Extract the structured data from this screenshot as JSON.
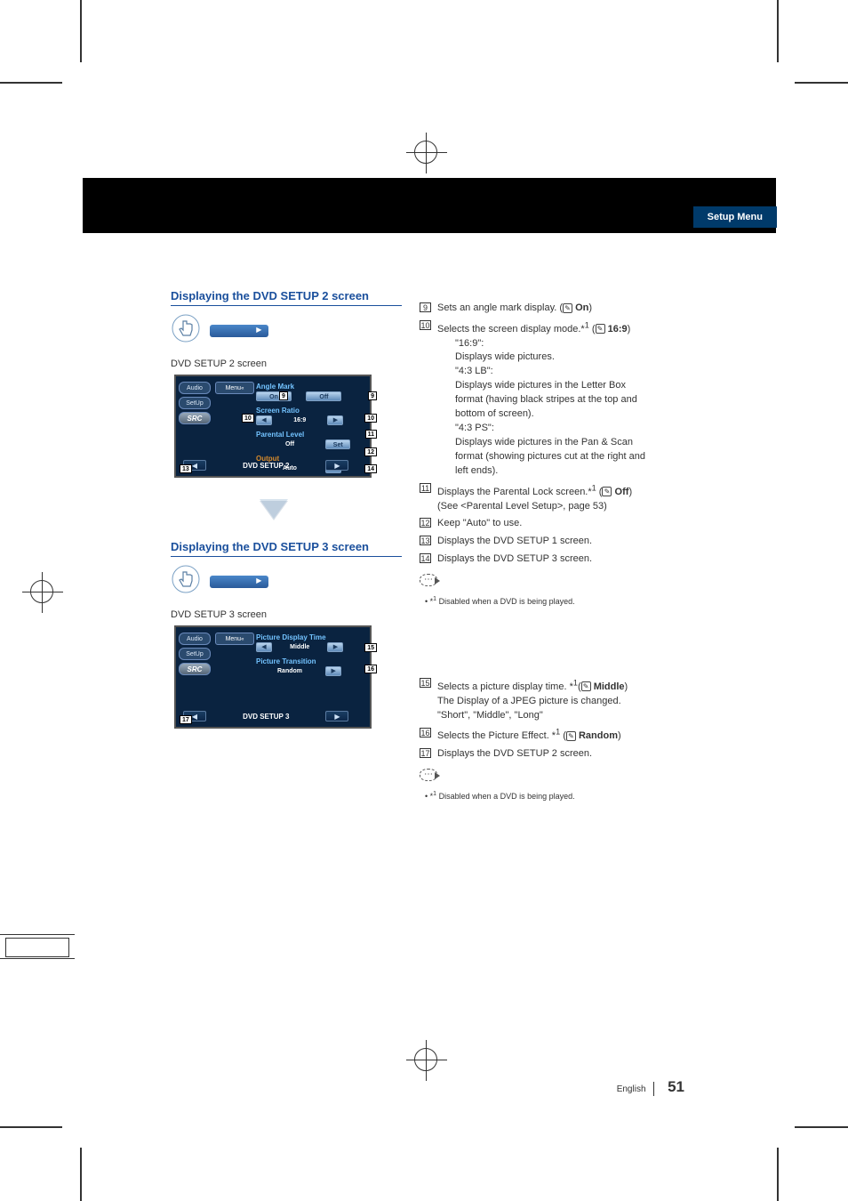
{
  "header": {
    "tab": "Setup Menu"
  },
  "section2": {
    "title": "Displaying the DVD SETUP 2 screen",
    "caption": "DVD SETUP 2 screen",
    "side": {
      "audio": "Audio",
      "setup": "SetUp",
      "src": "SRC"
    },
    "topbar": "Menu",
    "rows": {
      "angle": {
        "label": "Angle Mark",
        "on": "On",
        "off": "Off"
      },
      "ratio": {
        "label": "Screen Ratio",
        "value": "16:9"
      },
      "parental": {
        "label": "Parental Level",
        "off": "Off",
        "set": "Set"
      },
      "output": {
        "label": "Output",
        "value": "Auto"
      }
    },
    "footer": {
      "title": "DVD SETUP 2"
    }
  },
  "section3": {
    "title": "Displaying the DVD SETUP 3 screen",
    "caption": "DVD SETUP 3 screen",
    "side": {
      "audio": "Audio",
      "setup": "SetUp",
      "src": "SRC"
    },
    "topbar": "Menu",
    "rows": {
      "displaytime": {
        "label": "Picture Display Time",
        "value": "Middle"
      },
      "transition": {
        "label": "Picture Transition",
        "value": "Random"
      }
    },
    "footer": {
      "title": "DVD SETUP 3"
    }
  },
  "right2": {
    "i9": {
      "num": "9",
      "text": "Sets an angle mark display. (",
      "default": "On",
      "tail": ")"
    },
    "i10": {
      "num": "10",
      "text": "Selects the screen display mode.*",
      "sup": "1",
      "open": " (",
      "default": "16:9",
      "tail": ")",
      "d1k": "\"16:9\":",
      "d1v": "Displays wide pictures.",
      "d2k": "\"4:3 LB\":",
      "d2v": "Displays wide pictures in the Letter Box format (having black stripes at the top and bottom of screen).",
      "d3k": "\"4:3 PS\":",
      "d3v": "Displays wide pictures in the Pan & Scan format (showing pictures cut at the right and left ends)."
    },
    "i11": {
      "num": "11",
      "text": "Displays the Parental Lock screen.*",
      "sup": "1",
      "open": " (",
      "default": "Off",
      "tail": ")",
      "sub": "(See <Parental Level Setup>, page 53)"
    },
    "i12": {
      "num": "12",
      "text": "Keep \"Auto\" to use."
    },
    "i13": {
      "num": "13",
      "text": "Displays the DVD SETUP 1 screen."
    },
    "i14": {
      "num": "14",
      "text": "Displays the DVD SETUP 3 screen."
    },
    "note_bullet": "•",
    "note_star": " *",
    "note_sup": "1",
    "note": " Disabled when a DVD is being played."
  },
  "right3": {
    "i15": {
      "num": "15",
      "text": "Selects a picture display time. *",
      "sup": "1",
      "open": "(",
      "default": "Middle",
      "tail": ")",
      "sub1": "The Display of a JPEG picture is changed.",
      "sub2": "\"Short\", \"Middle\", \"Long\""
    },
    "i16": {
      "num": "16",
      "text": "Selects the Picture Effect. *",
      "sup": "1",
      "open": " (",
      "default": "Random",
      "tail": ")"
    },
    "i17": {
      "num": "17",
      "text": "Displays the DVD SETUP 2 screen."
    },
    "note_bullet": "•",
    "note_star": " *",
    "note_sup": "1",
    "note": " Disabled when a DVD is being played."
  },
  "callouts": {
    "n9": "9",
    "n10": "10",
    "n11": "11",
    "n12": "12",
    "n13": "13",
    "n14": "14",
    "n15": "15",
    "n16": "16",
    "n17": "17"
  },
  "footer": {
    "lang": "English",
    "page": "51"
  }
}
